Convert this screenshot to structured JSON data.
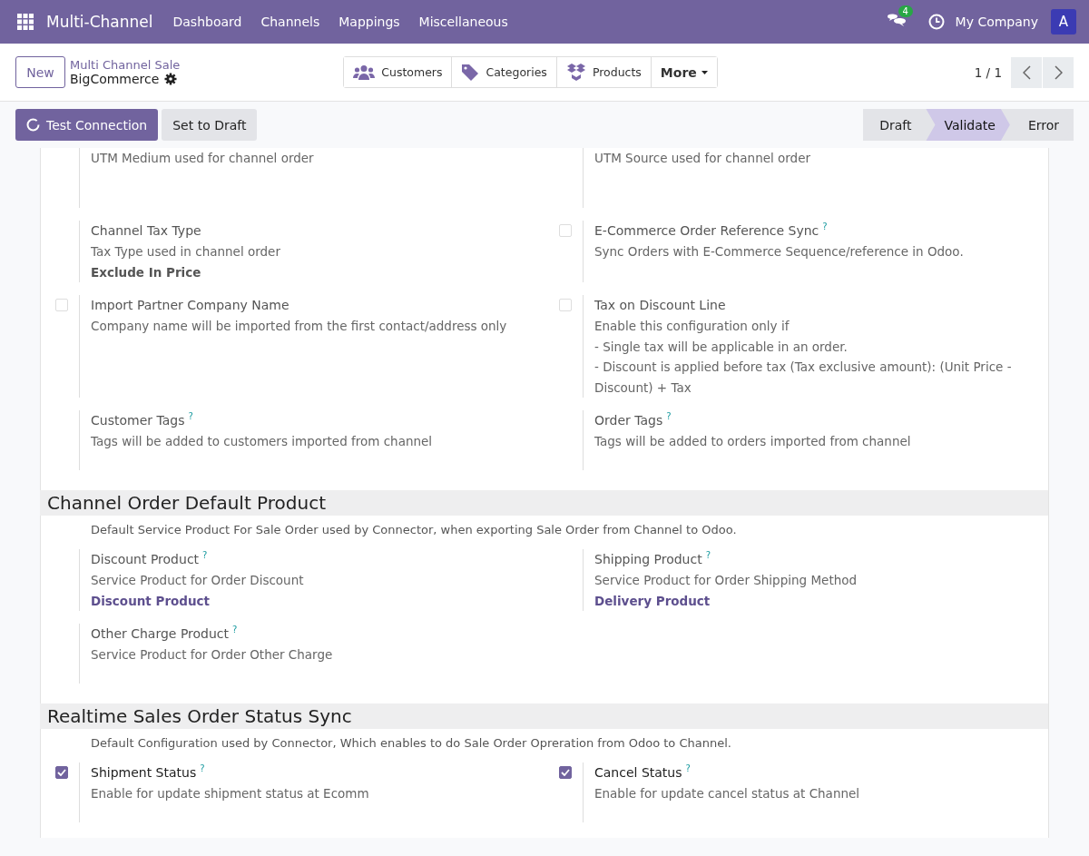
{
  "navbar": {
    "app_title": "Multi-Channel",
    "menu": [
      "Dashboard",
      "Channels",
      "Mappings",
      "Miscellaneous"
    ],
    "message_count": "4",
    "company": "My Company",
    "avatar_letter": "A"
  },
  "control_panel": {
    "new_button": "New",
    "breadcrumb_parent": "Multi Channel Sale",
    "record_name": "BigCommerce",
    "smart_buttons": [
      {
        "kind": "users",
        "label": "Customers"
      },
      {
        "kind": "tag",
        "label": "Categories"
      },
      {
        "kind": "boxes",
        "label": "Products"
      },
      {
        "kind": "more",
        "label": "More"
      }
    ],
    "pager": "1 / 1"
  },
  "status_bar": {
    "buttons": [
      {
        "label": "Test Connection",
        "primary": true
      },
      {
        "label": "Set to Draft",
        "primary": false
      }
    ],
    "stages": [
      {
        "label": "Draft",
        "selected": false
      },
      {
        "label": "Validate",
        "selected": true
      },
      {
        "label": "Error",
        "selected": false
      }
    ]
  },
  "sections": [
    {
      "settings": [
        {
          "description": [
            "UTM Medium used for channel order"
          ]
        },
        {
          "description": [
            "UTM Source used for channel order"
          ]
        },
        {
          "label": "Channel Tax Type",
          "description": [
            "Tax Type used in channel order"
          ],
          "value": "Exclude In Price",
          "kind": "plain"
        },
        {
          "checkbox": {
            "checked": false
          },
          "label": "E-Commerce Order Reference Sync",
          "help": "?",
          "description": [
            "Sync Orders with E-Commerce Sequence/reference in Odoo."
          ]
        },
        {
          "checkbox": {
            "checked": false
          },
          "label": "Import Partner Company Name",
          "description": [
            "Company name will be imported from the first contact/address only"
          ]
        },
        {
          "checkbox": {
            "checked": false
          },
          "label": "Tax on Discount Line",
          "description": [
            "Enable this configuration only if",
            "- Single tax will be applicable in an order.",
            "- Discount is applied before tax (Tax exclusive amount): (Unit Price - Discount) + Tax"
          ]
        },
        {
          "label": "Customer Tags",
          "help": "?",
          "description": [
            "Tags will be added to customers imported from channel"
          ]
        },
        {
          "label": "Order Tags",
          "help": "?",
          "description": [
            "Tags will be added to orders imported from channel"
          ]
        }
      ]
    },
    {
      "title": "Channel Order Default Product",
      "intro": "Default Service Product For Sale Order used by Connector, when exporting Sale Order from Channel to Odoo.",
      "settings": [
        {
          "label": "Discount Product",
          "help": "?",
          "description": [
            "Service Product for Order Discount"
          ],
          "value": "Discount Product",
          "kind": "link"
        },
        {
          "label": "Shipping Product",
          "help": "?",
          "description": [
            "Service Product for Order Shipping Method"
          ],
          "value": "Delivery Product",
          "kind": "link"
        },
        {
          "label": "Other Charge Product",
          "help": "?",
          "description": [
            "Service Product for Order Other Charge"
          ]
        }
      ]
    },
    {
      "title": "Realtime Sales Order Status Sync",
      "intro": "Default Configuration used by Connector, Which enables to do Sale Order Opreration from Odoo to Channel.",
      "settings": [
        {
          "checkbox": {
            "checked": true
          },
          "label": "Shipment Status",
          "help": "?",
          "description": [
            "Enable for update shipment status at Ecomm"
          ]
        },
        {
          "checkbox": {
            "checked": true
          },
          "label": "Cancel Status",
          "help": "?",
          "description": [
            "Enable for update cancel status at Channel"
          ]
        }
      ]
    }
  ]
}
